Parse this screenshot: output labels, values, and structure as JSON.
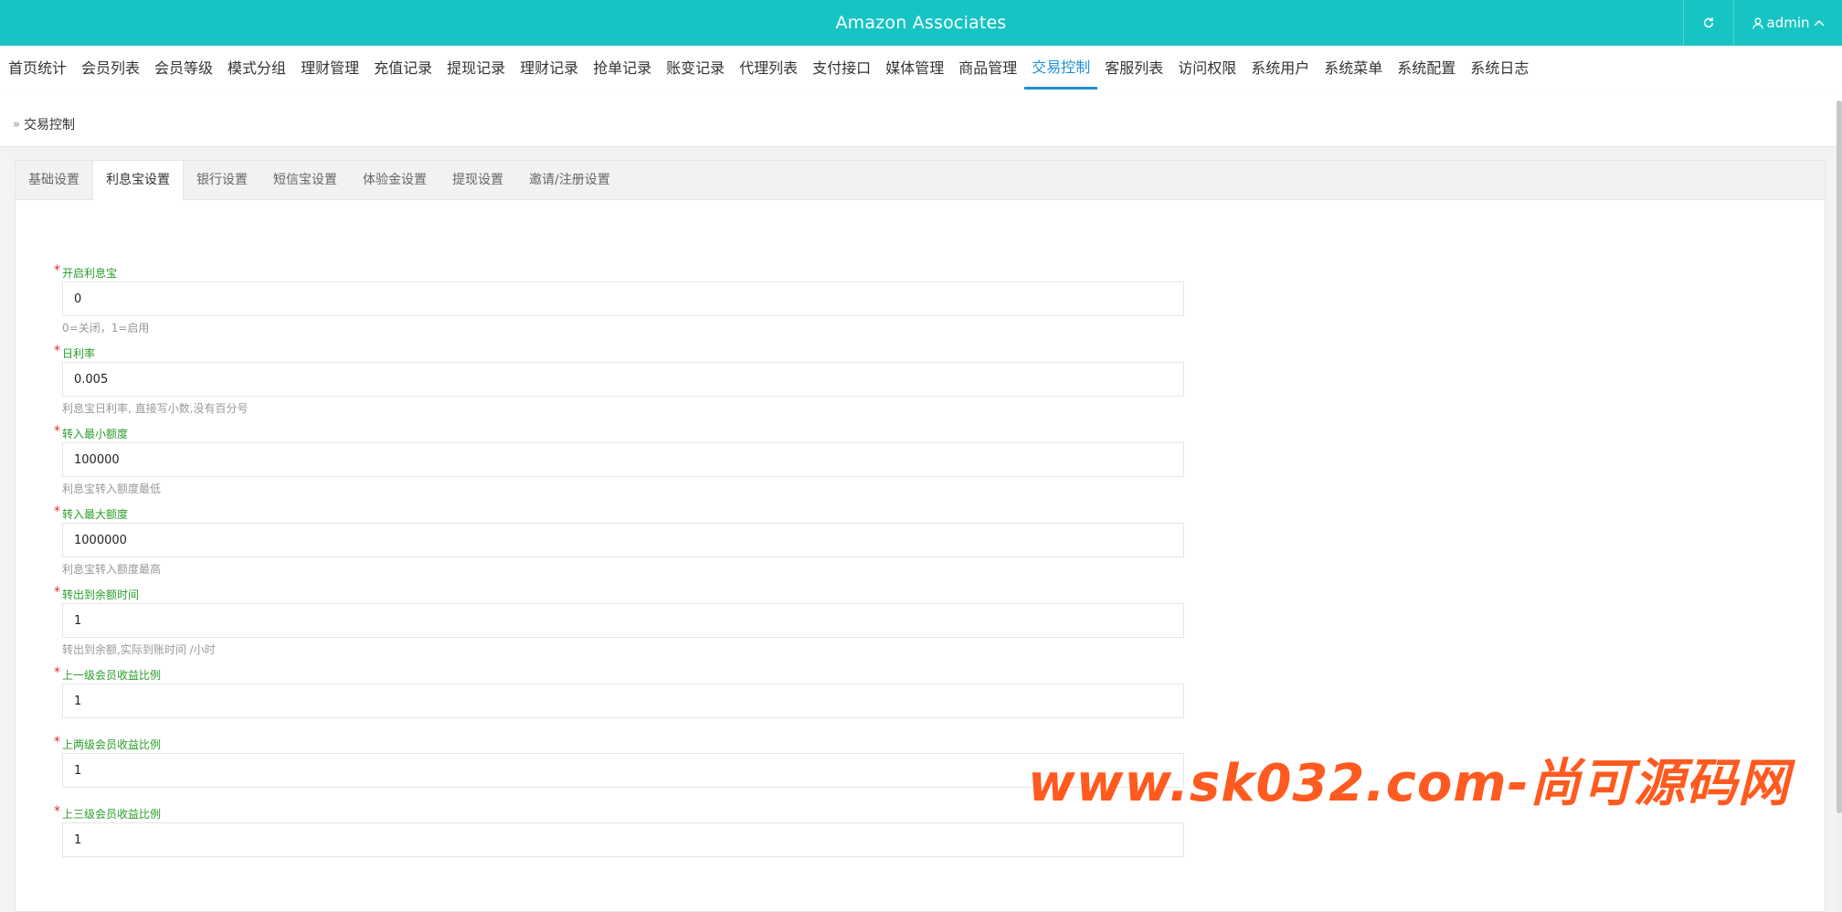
{
  "header": {
    "title": "Amazon Associates",
    "user_label": "admin"
  },
  "nav": {
    "items": [
      "首页统计",
      "会员列表",
      "会员等级",
      "模式分组",
      "理财管理",
      "充值记录",
      "提现记录",
      "理财记录",
      "抢单记录",
      "账变记录",
      "代理列表",
      "支付接口",
      "媒体管理",
      "商品管理",
      "交易控制",
      "客服列表",
      "访问权限",
      "系统用户",
      "系统菜单",
      "系统配置",
      "系统日志"
    ],
    "active": "交易控制"
  },
  "breadcrumb": {
    "current": "交易控制"
  },
  "tabs": {
    "items": [
      "基础设置",
      "利息宝设置",
      "银行设置",
      "短信宝设置",
      "体验金设置",
      "提现设置",
      "邀请/注册设置"
    ],
    "active": "利息宝设置"
  },
  "form": {
    "fields": [
      {
        "label": "开启利息宝",
        "value": "0",
        "help": "0=关闭，1=启用"
      },
      {
        "label": "日利率",
        "value": "0.005",
        "help": "利息宝日利率, 直接写小数,没有百分号"
      },
      {
        "label": "转入最小额度",
        "value": "100000",
        "help": "利息宝转入额度最低"
      },
      {
        "label": "转入最大额度",
        "value": "1000000",
        "help": "利息宝转入额度最高"
      },
      {
        "label": "转出到余额时间",
        "value": "1",
        "help": "转出到余额,实际到账时间 /小时"
      },
      {
        "label": "上一级会员收益比例",
        "value": "1",
        "help": ""
      },
      {
        "label": "上两级会员收益比例",
        "value": "1",
        "help": ""
      },
      {
        "label": "上三级会员收益比例",
        "value": "1",
        "help": ""
      }
    ]
  },
  "watermark": "www.sk032.com-尚可源码网",
  "colors": {
    "topbar": "#17c4c4",
    "nav_active": "#1e90d6",
    "label": "#2a9d2a",
    "required": "#e02b2b",
    "watermark": "#ff5a1f"
  },
  "icons": {
    "refresh": "refresh-icon",
    "user": "user-icon",
    "chevron": "chevron-up-icon",
    "breadcrumb": "double-chevron-right-icon"
  }
}
